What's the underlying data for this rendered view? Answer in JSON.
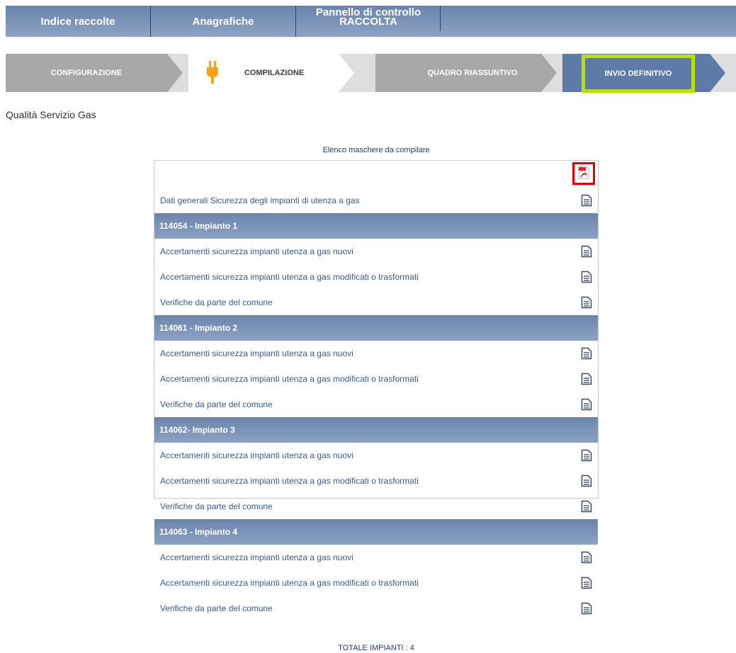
{
  "topnav": {
    "tab1": "Indice raccolte",
    "tab2": "Anagrafiche",
    "tab3_line1": "Pannello di controllo",
    "tab3_line2": "RACCOLTA"
  },
  "stepper": {
    "step1": "CONFIGURAZIONE",
    "step2": "COMPILAZIONE",
    "step3": "QUADRO RIASSUNTIVO",
    "step4": "INVIO DEFINITIVO"
  },
  "section_title": "Qualità Servizio Gas",
  "list_title": "Elenco maschere da compilare",
  "general_item": "Dati generali Sicurezza degli impianti di utenza a gas",
  "groups": [
    {
      "header": "114054 - Impianto 1",
      "items": [
        "Accertamenti sicurezza impianti utenza a gas nuovi",
        "Accertamenti sicurezza impianti utenza a gas modificati o trasformati",
        "Verifiche da parte del comune"
      ]
    },
    {
      "header": "114061 - Impianto 2",
      "items": [
        "Accertamenti sicurezza impianti utenza a gas nuovi",
        "Accertamenti sicurezza impianti utenza a gas modificati o trasformati",
        "Verifiche da parte del comune"
      ]
    },
    {
      "header": "114062- Impianto 3",
      "items": [
        "Accertamenti sicurezza impianti utenza a gas nuovi",
        "Accertamenti sicurezza impianti utenza a gas modificati o trasformati",
        "Verifiche da parte del comune"
      ]
    },
    {
      "header": "114063 - Impianto 4",
      "items": [
        "Accertamenti sicurezza impianti utenza a gas nuovi",
        "Accertamenti sicurezza impianti utenza a gas modificati o trasformati",
        "Verifiche da parte del comune"
      ]
    }
  ],
  "total": "TOTALE IMPIANTI : 4",
  "icons": {
    "pdf": "pdf-icon",
    "doc": "document-icon",
    "plug": "plug-icon"
  },
  "colors": {
    "nav": "#7a92b8",
    "highlight": "#b7e100",
    "active_step": "#5e7aa6",
    "pdf_highlight": "#e00000"
  }
}
